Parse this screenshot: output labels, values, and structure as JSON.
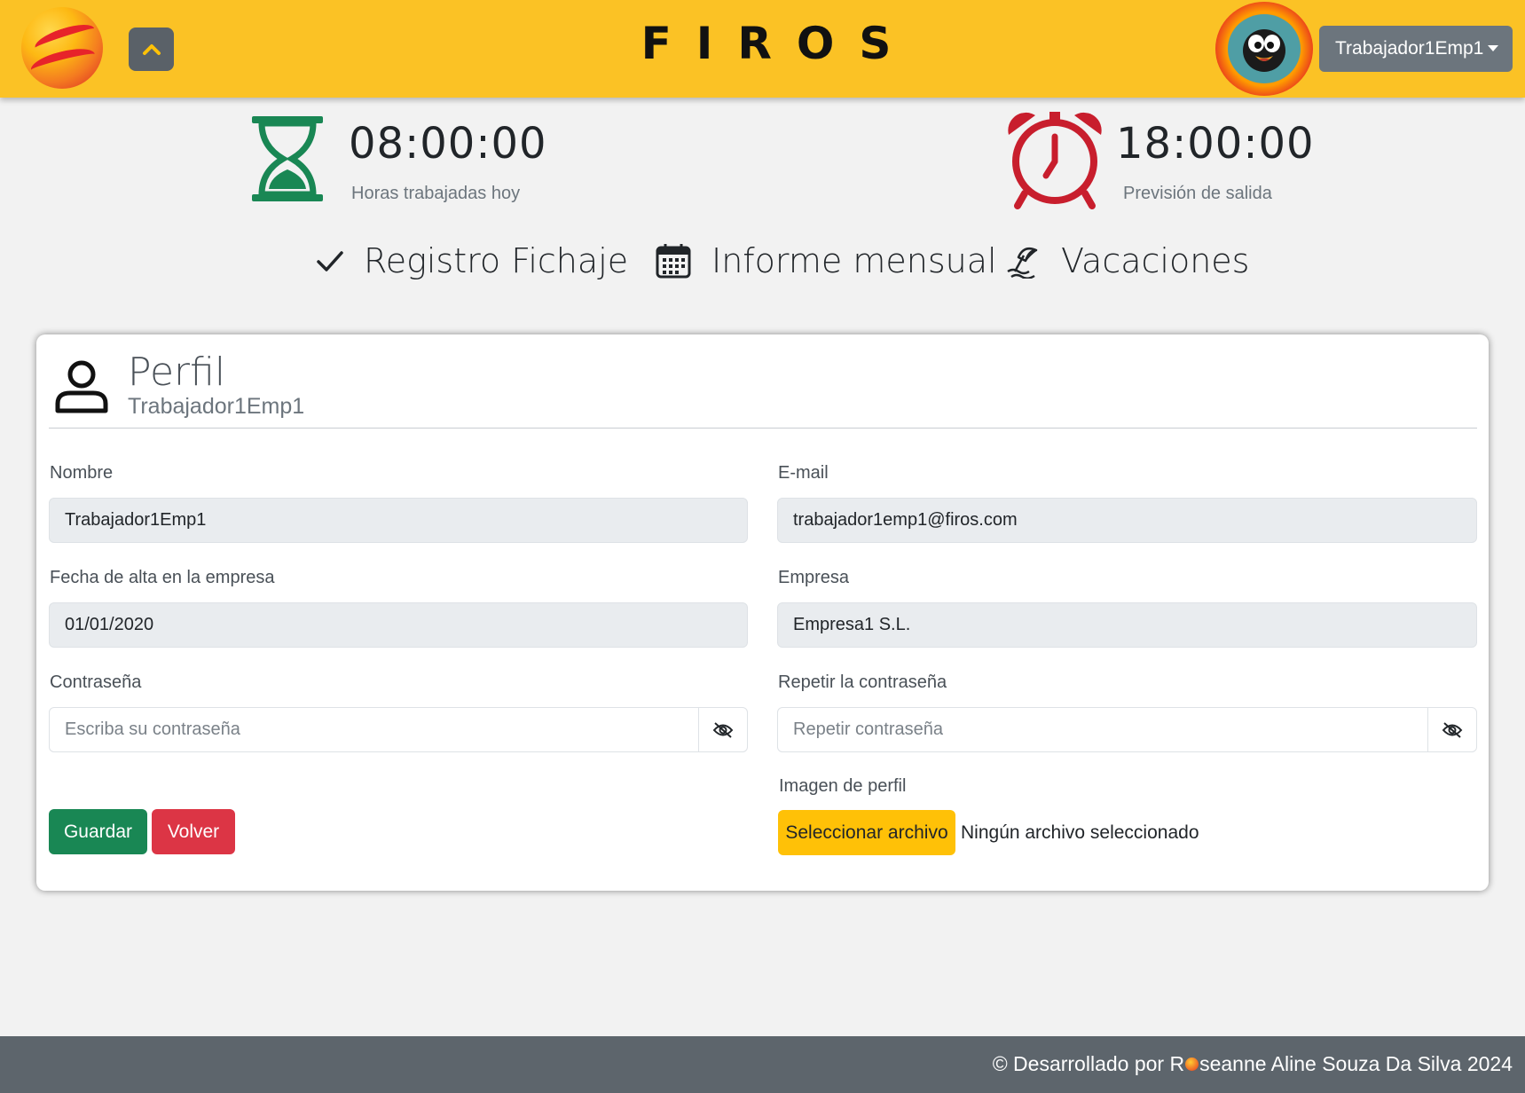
{
  "header": {
    "brand": "FIROS",
    "user_menu_label": "Trabajador1Emp1"
  },
  "timers": {
    "worked": {
      "value": "08:00:00",
      "label": "Horas trabajadas hoy",
      "icon": "hourglass-icon",
      "color": "#198754"
    },
    "exit": {
      "value": "18:00:00",
      "label": "Previsión de salida",
      "icon": "alarm-clock-icon",
      "color": "#c81e2d"
    }
  },
  "nav": {
    "items": [
      {
        "label": "Registro Fichaje",
        "icon": "check-icon"
      },
      {
        "label": "Informe mensual",
        "icon": "calendar-icon"
      },
      {
        "label": "Vacaciones",
        "icon": "beach-umbrella-icon"
      }
    ]
  },
  "profile": {
    "title": "Perfil",
    "subtitle": "Trabajador1Emp1",
    "icon": "person-icon",
    "fields": {
      "name": {
        "label": "Nombre",
        "value": "Trabajador1Emp1"
      },
      "email": {
        "label": "E-mail",
        "value": "trabajador1emp1@firos.com"
      },
      "hire_date": {
        "label": "Fecha de alta en la empresa",
        "value": "01/01/2020"
      },
      "company": {
        "label": "Empresa",
        "value": "Empresa1 S.L."
      },
      "password": {
        "label": "Contraseña",
        "placeholder": "Escriba su contraseña"
      },
      "password_repeat": {
        "label": "Repetir la contraseña",
        "placeholder": "Repetir contraseña"
      },
      "image": {
        "label": "Imagen de perfil",
        "button": "Seleccionar archivo",
        "status": "Ningún archivo seleccionado"
      }
    },
    "buttons": {
      "save": "Guardar",
      "back": "Volver"
    }
  },
  "footer": {
    "prefix": "© Desarrollado por R",
    "suffix": "seanne Aline Souza Da Silva 2024"
  },
  "colors": {
    "header_bg": "#fbc225",
    "footer_bg": "#5d656c",
    "save": "#198754",
    "back": "#dc3545",
    "file_button": "#ffc107"
  }
}
